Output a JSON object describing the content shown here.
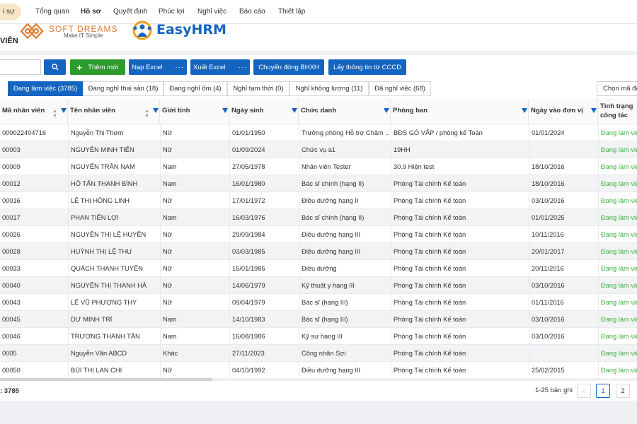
{
  "nav": {
    "active": "i sự",
    "items": [
      "Tổng quan",
      "Hồ sơ",
      "Quyết định",
      "Phúc lợi",
      "Nghỉ việc",
      "Báo cáo",
      "Thiết lập"
    ]
  },
  "logos": {
    "softdreams": "SOFT DREAMS",
    "softdreams_tagline": "Make IT Simple",
    "easyhrm": "EasyHRM"
  },
  "page_title": "VIÊN",
  "toolbar": {
    "search_placeholder": "",
    "add_label": "Thêm mới",
    "import_label": "Nạp Excel",
    "export_label": "Xuất Excel",
    "more_label": "···",
    "bhxh_label": "Chuyển đóng BHXH",
    "cccd_label": "Lấy thông tin từ CCCD"
  },
  "tabs": [
    "Đang làm việc (3785)",
    "Đang nghỉ thai sản (18)",
    "Đang nghỉ ốm (4)",
    "Nghỉ tạm thời (0)",
    "Nghỉ không lương (11)",
    "Đã nghỉ việc (68)"
  ],
  "choose_code_label": "Chọn mã đơ",
  "columns": [
    "Mã nhân viên",
    "Tên nhân viên",
    "Giới tính",
    "Ngày sinh",
    "Chức danh",
    "Phòng ban",
    "Ngày vào đơn vị",
    "Tình trạng công tác"
  ],
  "rows": [
    [
      "000022404716",
      "Nguyễn Thị Thơm",
      "Nữ",
      "01/01/1950",
      "Trưởng phòng Hỗ trợ Chăm ...",
      "BĐS GÒ VẤP / phòng kế Toán",
      "01/01/2024",
      "Đang làm việc"
    ],
    [
      "00003",
      "NGUYỄN MINH TIẾN",
      "Nữ",
      "01/09/2024",
      "Chức vụ a1",
      "19HH",
      "",
      "Đang làm việc"
    ],
    [
      "00009",
      "NGUYỄN TRẦN NAM",
      "Nam",
      "27/05/1978",
      "Nhân viên Tester",
      "30.9 Hiện test",
      "18/10/2016",
      "Đang làm việc"
    ],
    [
      "00012",
      "HỒ TẤN THANH BÌNH",
      "Nam",
      "16/01/1980",
      "Bác sĩ chính (hạng II)",
      "Phòng Tài chính Kế toán",
      "18/10/2016",
      "Đang làm việc"
    ],
    [
      "00016",
      "LÊ THỊ HỒNG LINH",
      "Nữ",
      "17/01/1972",
      "Điều dưỡng hạng II",
      "Phòng Tài chính Kế toán",
      "03/10/2016",
      "Đang làm việc"
    ],
    [
      "00017",
      "PHAN TIẾN LỢI",
      "Nam",
      "16/03/1976",
      "Bác sĩ chính (hạng II)",
      "Phòng Tài chính Kế toán",
      "01/01/2025",
      "Đang làm việc"
    ],
    [
      "00026",
      "NGUYỄN THỊ LỆ HUYỀN",
      "Nữ",
      "29/09/1984",
      "Điều dưỡng hạng III",
      "Phòng Tài chính Kế toán",
      "10/11/2016",
      "Đang làm việc"
    ],
    [
      "00028",
      "HUỲNH THỊ LỆ THU",
      "Nữ",
      "03/03/1985",
      "Điều dưỡng hạng III",
      "Phòng Tài chính Kế toán",
      "20/01/2017",
      "Đang làm việc"
    ],
    [
      "00033",
      "QUÁCH THANH TUYỀN",
      "Nữ",
      "15/01/1985",
      "Điều dưỡng",
      "Phòng Tài chính Kế toán",
      "20/11/2016",
      "Đang làm việc"
    ],
    [
      "00040",
      "NGUYỄN THỊ THANH HÀ",
      "Nữ",
      "14/06/1979",
      "Kỹ thuật y hạng III",
      "Phòng Tài chính Kế toán",
      "03/10/2016",
      "Đang làm việc"
    ],
    [
      "00043",
      "LÊ VŨ PHƯỢNG THY",
      "Nữ",
      "09/04/1979",
      "Bác sĩ (hạng III)",
      "Phòng Tài chính Kế toán",
      "01/11/2016",
      "Đang làm việc"
    ],
    [
      "00045",
      "DƯ MINH TRÍ",
      "Nam",
      "14/10/1983",
      "Bác sĩ (hạng III)",
      "Phòng Tài chính Kế toán",
      "03/10/2016",
      "Đang làm việc"
    ],
    [
      "00046",
      "TRƯƠNG THÀNH TÂN",
      "Nam",
      "16/08/1986",
      "Kỹ sư hạng III",
      "Phòng Tài chính Kế toán",
      "03/10/2016",
      "Đang làm việc"
    ],
    [
      "0005",
      "Nguyễn Văn ABCD",
      "Khác",
      "27/11/2023",
      "Công nhân Sợi",
      "Phòng Tài chính Kế toán",
      "",
      "Đang làm việc"
    ],
    [
      "00050",
      "BÙI THỊ LAN CHI",
      "Nữ",
      "04/10/1992",
      "Điều dưỡng hạng III",
      "Phòng Tài chính Kế toán",
      "25/02/2015",
      "Đang làm việc"
    ]
  ],
  "footer": {
    "total": ": 3785",
    "range": "1-25 bản ghi",
    "pages": [
      "1",
      "2"
    ]
  }
}
